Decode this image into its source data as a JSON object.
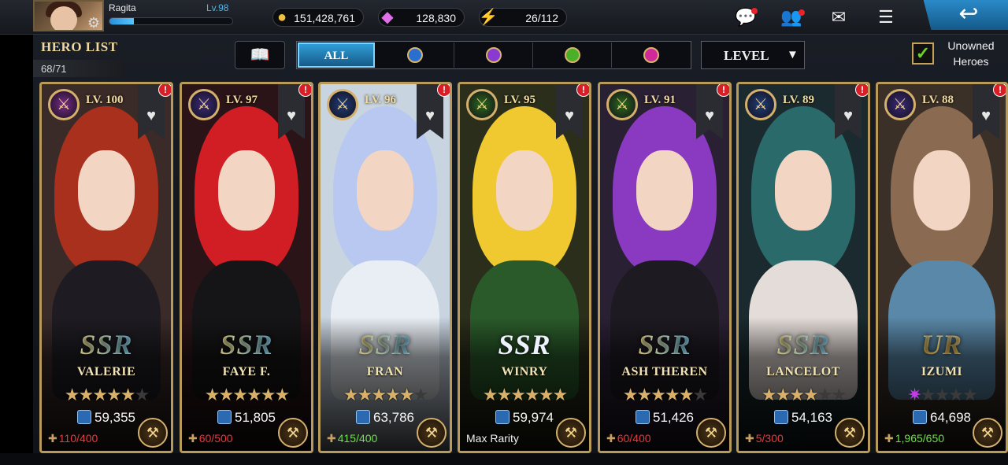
{
  "user": {
    "name": "Ragita",
    "level": "Lv.98",
    "xp_fraction": 0.2
  },
  "resources": [
    {
      "icon": "gold-coin-icon",
      "value": "151,428,761"
    },
    {
      "icon": "crystal-icon",
      "value": "128,830"
    },
    {
      "icon": "stamina-bolt-icon",
      "value": "26/112"
    }
  ],
  "header_icons": [
    "chat-icon",
    "friends-icon",
    "mail-icon",
    "menu-icon",
    "back-icon"
  ],
  "hero_list": {
    "title": "HERO LIST",
    "count": "68/71"
  },
  "filters": {
    "tabs": [
      {
        "label": "ALL",
        "active": true
      },
      {
        "label": "",
        "icon": "dagger-class-icon",
        "color": "#2a6fd0"
      },
      {
        "label": "",
        "icon": "sword-class-icon",
        "color": "#8a3ad0"
      },
      {
        "label": "",
        "icon": "bow-class-icon",
        "color": "#4ab02a"
      },
      {
        "label": "",
        "icon": "staff-class-icon",
        "color": "#d02a9a"
      }
    ],
    "sort": {
      "label": "LEVEL"
    },
    "unowned": {
      "label": "Unowned Heroes",
      "checked": true
    }
  },
  "heroes": [
    {
      "level": "LV. 100",
      "rarity": "SSR",
      "name": "VALERIE",
      "stars": 5,
      "power": "59,355",
      "fragments": "110/400",
      "fragment_color": "red",
      "class_color": "#7a2b8a",
      "hair": "#a8301c",
      "outfit": "#1e1c22",
      "bg": "#3a2a28"
    },
    {
      "level": "LV. 97",
      "rarity": "SSR",
      "name": "FAYE F.",
      "stars": 6,
      "power": "51,805",
      "fragments": "60/500",
      "fragment_color": "red",
      "class_color": "#3a2a7a",
      "hair": "#d01e24",
      "outfit": "#151517",
      "bg": "#2a1418"
    },
    {
      "level": "LV. 96",
      "rarity": "SSR",
      "name": "FRAN",
      "stars": 5,
      "power": "63,786",
      "fragments": "415/400",
      "fragment_color": "green",
      "class_color": "#1f3d7a",
      "hair": "#b8c8f0",
      "outfit": "#e8eef4",
      "bg": "#c8d4e0"
    },
    {
      "level": "LV. 95",
      "rarity": "SSR",
      "name": "WINRY",
      "stars": 6,
      "power": "59,974",
      "fragments": "Max Rarity",
      "fragment_color": "white",
      "class_color": "#2a6a1a",
      "hair": "#f0c830",
      "outfit": "#2a5a2a",
      "bg": "#2a2e1a"
    },
    {
      "level": "LV. 91",
      "rarity": "SSR",
      "name": "ASH THEREN",
      "stars": 5,
      "power": "51,426",
      "fragments": "60/400",
      "fragment_color": "red",
      "class_color": "#2a6a1a",
      "hair": "#8a3ac0",
      "outfit": "#1e1a22",
      "bg": "#2a2034"
    },
    {
      "level": "LV. 89",
      "rarity": "SSR",
      "name": "LANCELOT",
      "stars": 4,
      "power": "54,163",
      "fragments": "5/300",
      "fragment_color": "red",
      "class_color": "#1f3d7a",
      "hair": "#2a6a6a",
      "outfit": "#e4dcd8",
      "bg": "#1a2a2e"
    },
    {
      "level": "LV. 88",
      "rarity": "UR",
      "name": "IZUMI",
      "stars": 1,
      "power": "64,698",
      "fragments": "1,965/650",
      "fragment_color": "green",
      "class_color": "#3a2a7a",
      "hair": "#8a6a50",
      "outfit": "#5a88a8",
      "bg": "#3a3028"
    }
  ]
}
